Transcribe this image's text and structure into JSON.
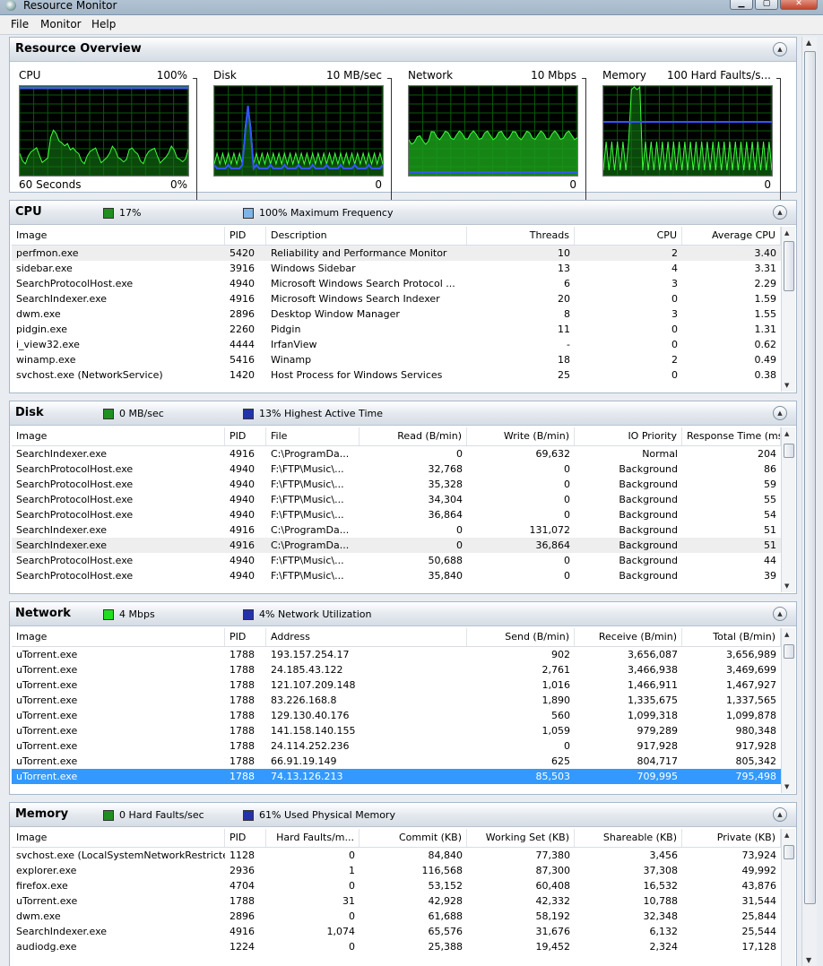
{
  "window": {
    "title": "Resource Monitor"
  },
  "menu": [
    "File",
    "Monitor",
    "Help"
  ],
  "overview": {
    "title": "Resource Overview",
    "graphs": [
      {
        "name": "CPU",
        "max": "100%",
        "foot_left": "60 Seconds",
        "foot_right": "0%"
      },
      {
        "name": "Disk",
        "max": "10 MB/sec",
        "foot_left": "",
        "foot_right": "0"
      },
      {
        "name": "Network",
        "max": "10 Mbps",
        "foot_left": "",
        "foot_right": "0"
      },
      {
        "name": "Memory",
        "max": "100 Hard Faults/s...",
        "foot_left": "",
        "foot_right": "0"
      }
    ]
  },
  "colors": {
    "green_swatch": "#1f8f1f",
    "bright_green_swatch": "#22dd22",
    "blue_swatch": "#2233aa",
    "light_blue_swatch": "#7fb4e8",
    "selection": "#3399ff"
  },
  "cpu": {
    "title": "CPU",
    "legend1": "17%",
    "legend2": "100% Maximum Frequency",
    "columns": [
      "Image",
      "PID",
      "Description",
      "Threads",
      "CPU",
      "Average CPU"
    ],
    "rows": [
      [
        "perfmon.exe",
        "5420",
        "Reliability and Performance Monitor",
        "10",
        "2",
        "3.40"
      ],
      [
        "sidebar.exe",
        "3916",
        "Windows Sidebar",
        "13",
        "4",
        "3.31"
      ],
      [
        "SearchProtocolHost.exe",
        "4940",
        "Microsoft Windows Search Protocol ...",
        "6",
        "3",
        "2.29"
      ],
      [
        "SearchIndexer.exe",
        "4916",
        "Microsoft Windows Search Indexer",
        "20",
        "0",
        "1.59"
      ],
      [
        "dwm.exe",
        "2896",
        "Desktop Window Manager",
        "8",
        "3",
        "1.55"
      ],
      [
        "pidgin.exe",
        "2260",
        "Pidgin",
        "11",
        "0",
        "1.31"
      ],
      [
        "i_view32.exe",
        "4444",
        "IrfanView",
        "-",
        "0",
        "0.62"
      ],
      [
        "winamp.exe",
        "5416",
        "Winamp",
        "18",
        "2",
        "0.49"
      ],
      [
        "svchost.exe (NetworkService)",
        "1420",
        "Host Process for Windows Services",
        "25",
        "0",
        "0.38"
      ]
    ]
  },
  "disk": {
    "title": "Disk",
    "legend1": "0 MB/sec",
    "legend2": "13% Highest Active Time",
    "columns": [
      "Image",
      "PID",
      "File",
      "Read (B/min)",
      "Write (B/min)",
      "IO Priority",
      "Response Time (ms)"
    ],
    "rows": [
      [
        "SearchIndexer.exe",
        "4916",
        "C:\\ProgramDa...",
        "0",
        "69,632",
        "Normal",
        "204"
      ],
      [
        "SearchProtocolHost.exe",
        "4940",
        "F:\\FTP\\Music\\...",
        "32,768",
        "0",
        "Background",
        "86"
      ],
      [
        "SearchProtocolHost.exe",
        "4940",
        "F:\\FTP\\Music\\...",
        "35,328",
        "0",
        "Background",
        "59"
      ],
      [
        "SearchProtocolHost.exe",
        "4940",
        "F:\\FTP\\Music\\...",
        "34,304",
        "0",
        "Background",
        "55"
      ],
      [
        "SearchProtocolHost.exe",
        "4940",
        "F:\\FTP\\Music\\...",
        "36,864",
        "0",
        "Background",
        "54"
      ],
      [
        "SearchIndexer.exe",
        "4916",
        "C:\\ProgramDa...",
        "0",
        "131,072",
        "Background",
        "51"
      ],
      [
        "SearchIndexer.exe",
        "4916",
        "C:\\ProgramDa...",
        "0",
        "36,864",
        "Background",
        "51"
      ],
      [
        "SearchProtocolHost.exe",
        "4940",
        "F:\\FTP\\Music\\...",
        "50,688",
        "0",
        "Background",
        "44"
      ],
      [
        "SearchProtocolHost.exe",
        "4940",
        "F:\\FTP\\Music\\...",
        "35,840",
        "0",
        "Background",
        "39"
      ]
    ]
  },
  "network": {
    "title": "Network",
    "legend1": "4 Mbps",
    "legend2": "4% Network Utilization",
    "columns": [
      "Image",
      "PID",
      "Address",
      "Send (B/min)",
      "Receive (B/min)",
      "Total (B/min)"
    ],
    "rows": [
      [
        "uTorrent.exe",
        "1788",
        "193.157.254.17",
        "902",
        "3,656,087",
        "3,656,989"
      ],
      [
        "uTorrent.exe",
        "1788",
        "24.185.43.122",
        "2,761",
        "3,466,938",
        "3,469,699"
      ],
      [
        "uTorrent.exe",
        "1788",
        "121.107.209.148",
        "1,016",
        "1,466,911",
        "1,467,927"
      ],
      [
        "uTorrent.exe",
        "1788",
        "83.226.168.8",
        "1,890",
        "1,335,675",
        "1,337,565"
      ],
      [
        "uTorrent.exe",
        "1788",
        "129.130.40.176",
        "560",
        "1,099,318",
        "1,099,878"
      ],
      [
        "uTorrent.exe",
        "1788",
        "141.158.140.155",
        "1,059",
        "979,289",
        "980,348"
      ],
      [
        "uTorrent.exe",
        "1788",
        "24.114.252.236",
        "0",
        "917,928",
        "917,928"
      ],
      [
        "uTorrent.exe",
        "1788",
        "66.91.19.149",
        "625",
        "804,717",
        "805,342"
      ],
      [
        "uTorrent.exe",
        "1788",
        "74.13.126.213",
        "85,503",
        "709,995",
        "795,498"
      ]
    ]
  },
  "memory": {
    "title": "Memory",
    "legend1": "0 Hard Faults/sec",
    "legend2": "61% Used Physical Memory",
    "columns": [
      "Image",
      "PID",
      "Hard Faults/m...",
      "Commit (KB)",
      "Working Set (KB)",
      "Shareable (KB)",
      "Private (KB)"
    ],
    "rows": [
      [
        "svchost.exe (LocalSystemNetworkRestricted)",
        "1128",
        "0",
        "84,840",
        "77,380",
        "3,456",
        "73,924"
      ],
      [
        "explorer.exe",
        "2936",
        "1",
        "116,568",
        "87,300",
        "37,308",
        "49,992"
      ],
      [
        "firefox.exe",
        "4704",
        "0",
        "53,152",
        "60,408",
        "16,532",
        "43,876"
      ],
      [
        "uTorrent.exe",
        "1788",
        "31",
        "42,928",
        "42,332",
        "10,788",
        "31,544"
      ],
      [
        "dwm.exe",
        "2896",
        "0",
        "61,688",
        "58,192",
        "32,348",
        "25,844"
      ],
      [
        "SearchIndexer.exe",
        "4916",
        "1,074",
        "65,576",
        "31,676",
        "6,132",
        "25,544"
      ],
      [
        "audiodg.exe",
        "1224",
        "0",
        "25,388",
        "19,452",
        "2,324",
        "17,128"
      ]
    ]
  }
}
